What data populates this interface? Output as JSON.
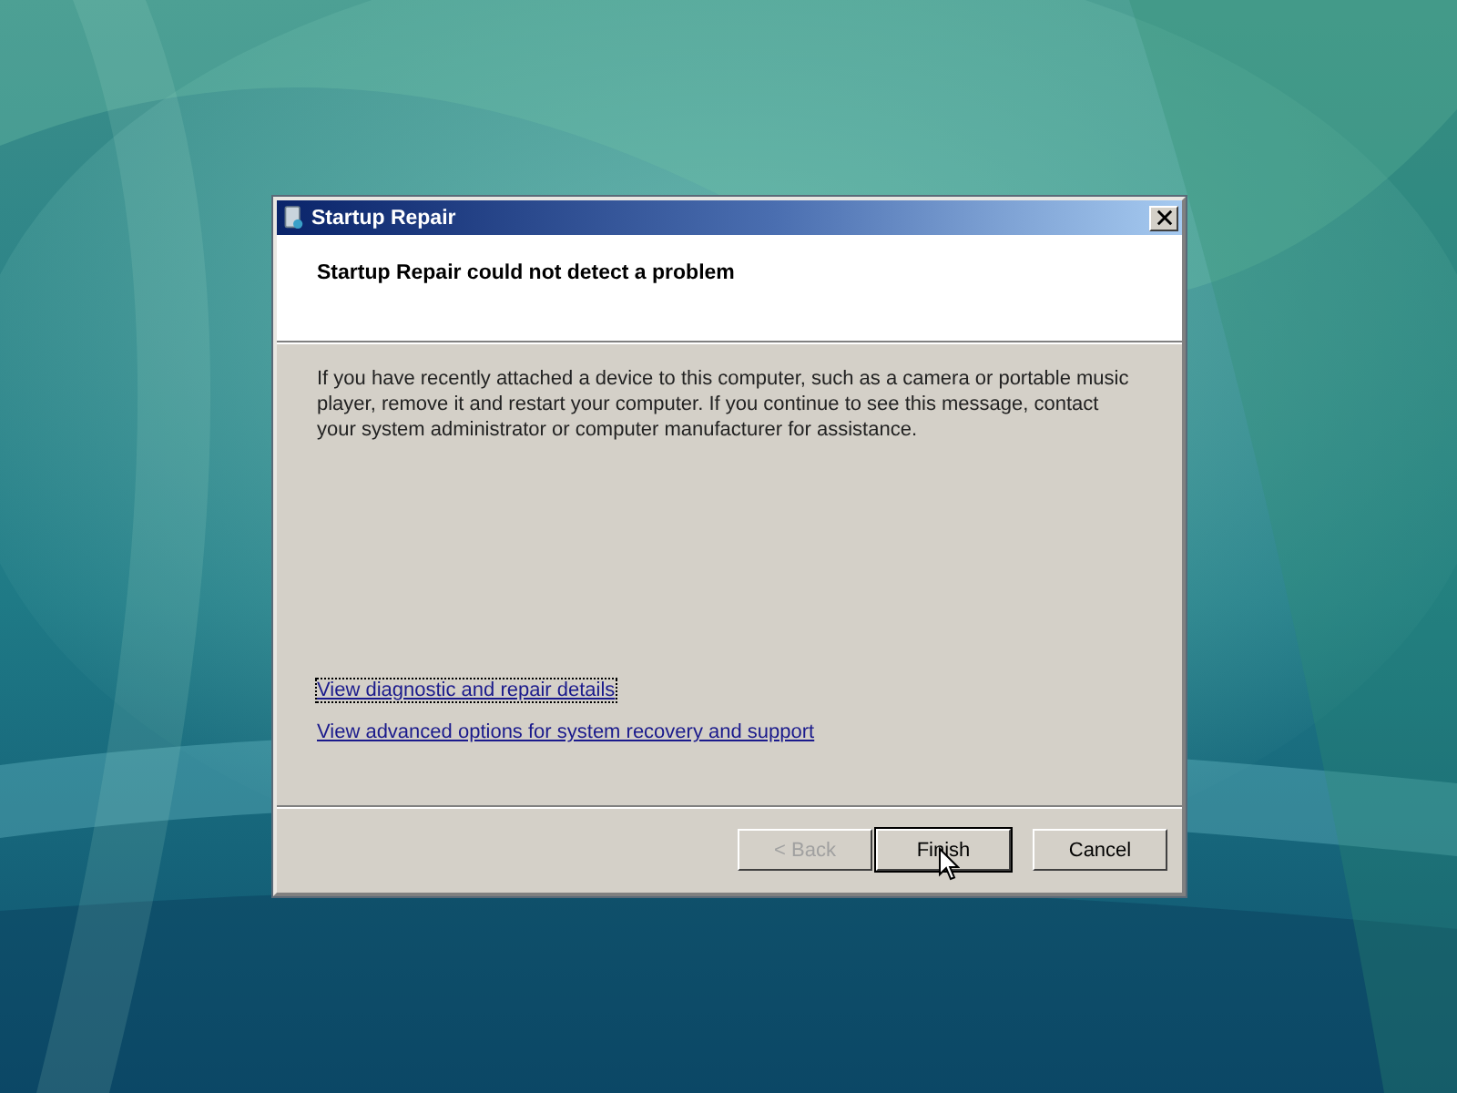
{
  "window": {
    "title": "Startup Repair"
  },
  "heading": "Startup Repair could not detect a problem",
  "message": "If you have recently attached a device to this computer, such as a camera or portable music player, remove it and restart your computer. If you continue to see this message, contact your system administrator or computer manufacturer for assistance.",
  "links": [
    {
      "label": "View diagnostic and repair details",
      "focused": true
    },
    {
      "label": "View advanced options for system recovery and support",
      "focused": false
    }
  ],
  "buttons": [
    {
      "label": "< Back",
      "disabled": true,
      "default": false
    },
    {
      "label": "Finish",
      "disabled": false,
      "default": true
    },
    {
      "label": "Cancel",
      "disabled": false,
      "default": false
    }
  ]
}
